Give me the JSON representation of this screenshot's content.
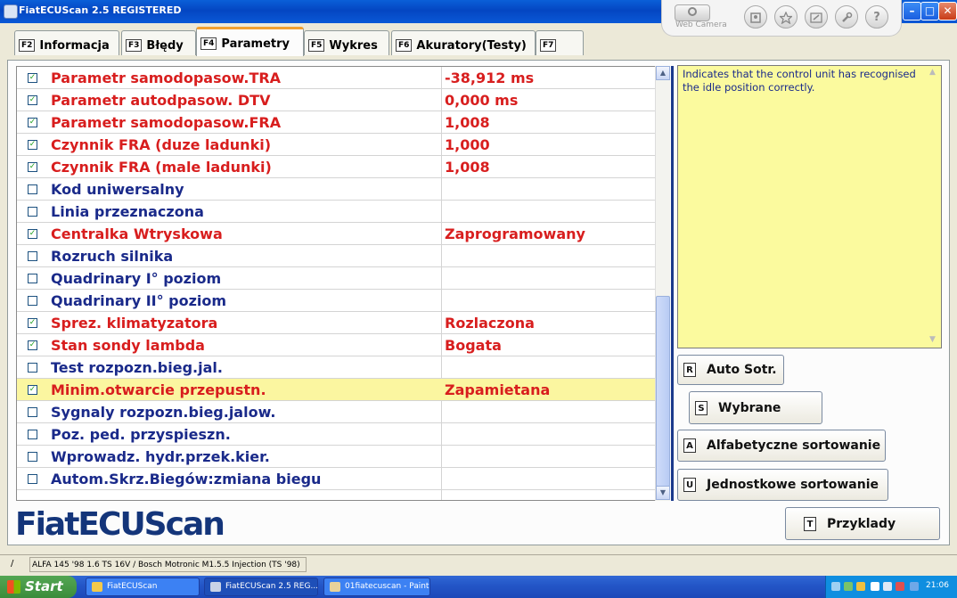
{
  "window": {
    "title": "FiatECUScan 2.5 REGISTERED",
    "webcam_label": "Web Camera",
    "help_glyph": "?",
    "minimize_glyph": "–",
    "maximize_glyph": "□",
    "close_glyph": "✕"
  },
  "tabs": [
    {
      "key": "F2",
      "label": "Informacja"
    },
    {
      "key": "F3",
      "label": "Błędy"
    },
    {
      "key": "F4",
      "label": "Parametry",
      "active": true
    },
    {
      "key": "F5",
      "label": "Wykres"
    },
    {
      "key": "F6",
      "label": "Akuratory(Testy)"
    },
    {
      "key": "F7",
      "label": ""
    }
  ],
  "parameters": [
    {
      "checked": true,
      "check_glyph": "✓",
      "name": "Parametr samodopasow.TRA",
      "value": "-38,912 ms"
    },
    {
      "checked": true,
      "check_glyph": "✓",
      "name": "Parametr autodpasow. DTV",
      "value": "0,000 ms"
    },
    {
      "checked": true,
      "check_glyph": "✓",
      "name": "Parametr samodopasow.FRA",
      "value": "1,008"
    },
    {
      "checked": true,
      "check_glyph": "✓",
      "name": "Czynnik FRA (duze ladunki)",
      "value": "1,000"
    },
    {
      "checked": true,
      "check_glyph": "✓",
      "name": "Czynnik FRA (male ladunki)",
      "value": "1,008"
    },
    {
      "checked": false,
      "check_glyph": "",
      "name": "Kod uniwersalny",
      "value": ""
    },
    {
      "checked": false,
      "check_glyph": "",
      "name": "Linia przeznaczona",
      "value": ""
    },
    {
      "checked": true,
      "check_glyph": "✓",
      "name": "Centralka Wtryskowa",
      "value": "Zaprogramowany"
    },
    {
      "checked": false,
      "check_glyph": "",
      "name": "Rozruch silnika",
      "value": ""
    },
    {
      "checked": false,
      "check_glyph": "",
      "name": "Quadrinary  I° poziom",
      "value": ""
    },
    {
      "checked": false,
      "check_glyph": "",
      "name": "Quadrinary  II° poziom",
      "value": ""
    },
    {
      "checked": true,
      "check_glyph": "✓",
      "name": "Sprez. klimatyzatora",
      "value": "Rozlaczona"
    },
    {
      "checked": true,
      "check_glyph": "✓",
      "name": "Stan sondy lambda",
      "value": "Bogata"
    },
    {
      "checked": false,
      "check_glyph": "",
      "name": "Test rozpozn.bieg.jal.",
      "value": ""
    },
    {
      "checked": true,
      "check_glyph": "✓",
      "name": "Minim.otwarcie przepustn.",
      "value": "Zapamietana",
      "selected": true
    },
    {
      "checked": false,
      "check_glyph": "",
      "name": "Sygnaly rozpozn.bieg.jalow.",
      "value": ""
    },
    {
      "checked": false,
      "check_glyph": "",
      "name": "Poz. ped. przyspieszn.",
      "value": ""
    },
    {
      "checked": false,
      "check_glyph": "",
      "name": "Wprowadz. hydr.przek.kier.",
      "value": ""
    },
    {
      "checked": false,
      "check_glyph": "",
      "name": "Autom.Skrz.Biegów:zmiana biegu",
      "value": ""
    }
  ],
  "description": "Indicates that the control unit has recognised the idle position correctly.",
  "buttons": {
    "auto_sort": {
      "key": "R",
      "label": "Auto Sotr."
    },
    "selected": {
      "key": "S",
      "label": "Wybrane"
    },
    "alpha_sort": {
      "key": "A",
      "label": "Alfabetyczne sortowanie"
    },
    "unit_sort": {
      "key": "U",
      "label": "Jednostkowe sortowanie"
    },
    "examples": {
      "key": "T",
      "label": "Przyklady"
    }
  },
  "logo": "FiatECUScan",
  "status": {
    "separator": "/",
    "vehicle": "ALFA 145 '98 1.6 TS 16V / Bosch Motronic M1.5.5 Injection (TS '98)"
  },
  "taskbar": {
    "start_label": "Start",
    "items": [
      {
        "label": "FiatECUScan",
        "active": false
      },
      {
        "label": "FiatECUScan 2.5 REG...",
        "active": true
      },
      {
        "label": "01fiatecuscan - Paint",
        "active": false
      }
    ],
    "clock": "21:06"
  },
  "scroll": {
    "up_glyph": "▲",
    "down_glyph": "▼"
  },
  "colors": {
    "checked_text": "#d81e1e",
    "unchecked_text": "#1a2a8a",
    "selected_row": "#fbf6a0",
    "description_bg": "#fbfa9e",
    "logo": "#14357a"
  }
}
